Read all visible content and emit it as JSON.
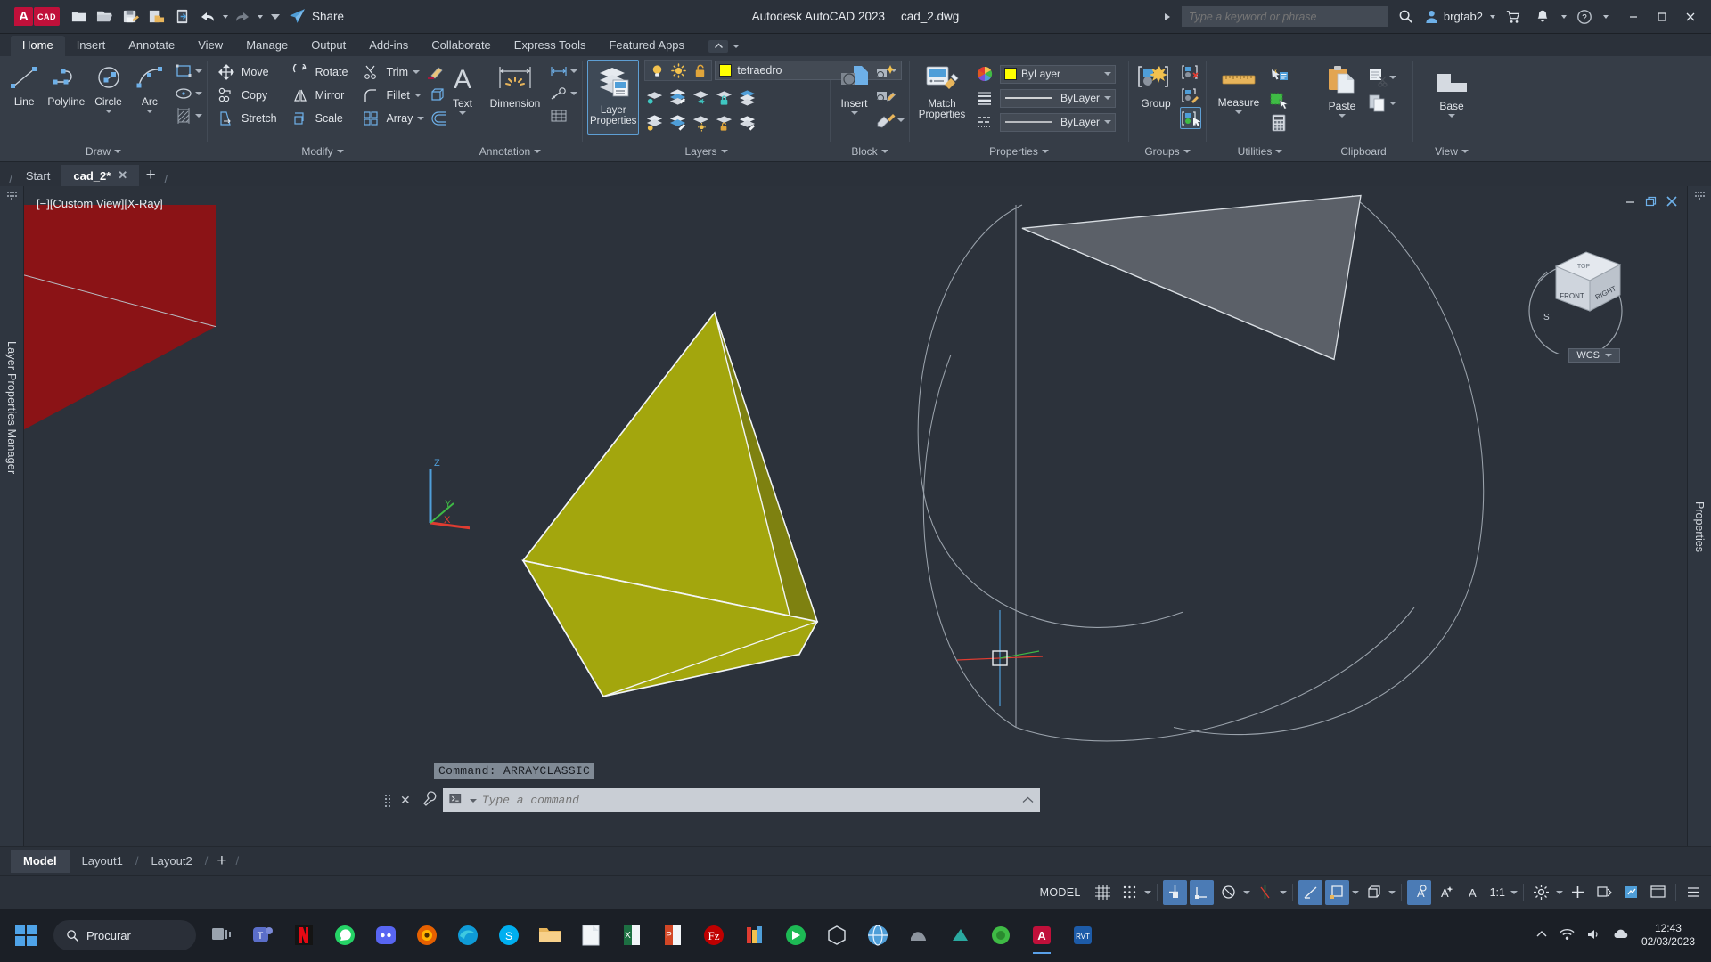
{
  "titlebar": {
    "logo_a": "A",
    "logo_cad": "CAD",
    "share_label": "Share",
    "app_title": "Autodesk AutoCAD 2023",
    "file_name": "cad_2.dwg",
    "search_placeholder": "Type a keyword or phrase",
    "user_name": "brgtab2",
    "quick_access": [
      {
        "name": "new-icon",
        "label": "New"
      },
      {
        "name": "open-icon",
        "label": "Open"
      },
      {
        "name": "save-icon",
        "label": "Save"
      },
      {
        "name": "save-as-icon",
        "label": "Save As"
      },
      {
        "name": "plot-icon",
        "label": "Plot"
      },
      {
        "name": "undo-icon",
        "label": "Undo"
      },
      {
        "name": "redo-icon",
        "label": "Redo"
      }
    ]
  },
  "ribbon_tabs": [
    {
      "label": "Home",
      "active": true
    },
    {
      "label": "Insert",
      "active": false
    },
    {
      "label": "Annotate",
      "active": false
    },
    {
      "label": "View",
      "active": false
    },
    {
      "label": "Manage",
      "active": false
    },
    {
      "label": "Output",
      "active": false
    },
    {
      "label": "Add-ins",
      "active": false
    },
    {
      "label": "Collaborate",
      "active": false
    },
    {
      "label": "Express Tools",
      "active": false
    },
    {
      "label": "Featured Apps",
      "active": false
    }
  ],
  "panels": {
    "draw": {
      "label": "Draw",
      "buttons": [
        {
          "label": "Line",
          "icon": "line-icon",
          "dropdown": false
        },
        {
          "label": "Polyline",
          "icon": "polyline-icon",
          "dropdown": false
        },
        {
          "label": "Circle",
          "icon": "circle-icon",
          "dropdown": true
        },
        {
          "label": "Arc",
          "icon": "arc-icon",
          "dropdown": true
        }
      ],
      "small": [
        {
          "icon": "rectangle-icon",
          "dropdown": true
        },
        {
          "icon": "ellipse-icon",
          "dropdown": true
        },
        {
          "icon": "hatch-icon",
          "dropdown": true
        }
      ]
    },
    "modify": {
      "label": "Modify",
      "items": [
        {
          "label": "Move",
          "icon": "move-icon"
        },
        {
          "label": "Rotate",
          "icon": "rotate-icon"
        },
        {
          "label": "Trim",
          "icon": "trim-icon",
          "dropdown": true
        },
        {
          "label": "Copy",
          "icon": "copy-icon"
        },
        {
          "label": "Mirror",
          "icon": "mirror-icon"
        },
        {
          "label": "Fillet",
          "icon": "fillet-icon",
          "dropdown": true
        },
        {
          "label": "Stretch",
          "icon": "stretch-icon"
        },
        {
          "label": "Scale",
          "icon": "scale-icon"
        },
        {
          "label": "Array",
          "icon": "array-icon",
          "dropdown": true
        }
      ],
      "extra": [
        {
          "icon": "erase-icon"
        },
        {
          "icon": "3d-solid-icon"
        },
        {
          "icon": "offset-icon"
        }
      ]
    },
    "annotation": {
      "label": "Annotation",
      "text_label": "Text",
      "dimension_label": "Dimension",
      "small": [
        {
          "icon": "linear-dimension-icon",
          "dropdown": true
        },
        {
          "icon": "leader-icon",
          "dropdown": true
        },
        {
          "icon": "table-icon",
          "dropdown": false
        }
      ]
    },
    "layers": {
      "label": "Layers",
      "layer_properties_label": "Layer Properties",
      "current_layer": "tetraedro",
      "layer_color": "#ffff00",
      "toggles": [
        {
          "name": "layer-on-icon"
        },
        {
          "name": "layer-freeze-sun-icon"
        },
        {
          "name": "layer-unlock-icon"
        }
      ],
      "grid_icons": [
        "layer-isolate-icon",
        "layer-unisolate-icon",
        "layer-freeze-icon",
        "layer-lock-icon",
        "layer-make-current-icon",
        "layer-off-icon",
        "layer-match-icon",
        "layer-thaw-all-icon",
        "layer-unlock-obj-icon",
        "layer-previous-icon"
      ]
    },
    "block": {
      "label": "Block",
      "insert_label": "Insert",
      "small": [
        {
          "icon": "create-block-icon"
        },
        {
          "icon": "edit-block-icon"
        },
        {
          "icon": "edit-attribute-icon",
          "dropdown": true
        }
      ]
    },
    "properties": {
      "label": "Properties",
      "match_properties_label": "Match Properties",
      "rows": [
        {
          "icon": "color-wheel-icon",
          "swatch": "#ffff00",
          "value": "ByLayer",
          "kind": "color"
        },
        {
          "icon": "lineweight-icon",
          "value": "ByLayer",
          "kind": "lineweight"
        },
        {
          "icon": "linetype-icon",
          "value": "ByLayer",
          "kind": "linetype"
        }
      ]
    },
    "groups": {
      "label": "Groups",
      "group_label": "Group",
      "small": [
        {
          "icon": "ungroup-icon"
        },
        {
          "icon": "group-edit-icon"
        },
        {
          "icon": "group-selection-icon",
          "active": true
        }
      ]
    },
    "utilities": {
      "label": "Utilities",
      "measure_label": "Measure",
      "small": [
        {
          "icon": "quick-select-icon"
        },
        {
          "icon": "quick-calc-area-icon"
        },
        {
          "icon": "calculator-icon"
        }
      ]
    },
    "clipboard": {
      "label": "Clipboard",
      "paste_label": "Paste",
      "small": [
        {
          "icon": "cut-icon",
          "dropdown": true
        },
        {
          "icon": "copy-clip-icon",
          "dropdown": true
        }
      ]
    },
    "view": {
      "label": "View",
      "base_label": "Base"
    }
  },
  "file_tabs": [
    {
      "label": "Start",
      "active": false,
      "closable": false
    },
    {
      "label": "cad_2*",
      "active": true,
      "closable": true
    }
  ],
  "viewport": {
    "label": "[−][Custom View][X-Ray]",
    "viewcube": {
      "top": "TOP",
      "front": "FRONT",
      "right": "RIGHT",
      "compass_s": "S"
    },
    "wcs_label": "WCS",
    "ucs_axes": {
      "x": "X",
      "y": "Y",
      "z": "Z"
    },
    "colors": {
      "background": "#2c323b",
      "tetra_fill": "#a3a60d",
      "tetra_fill_dark": "#7e8110",
      "highlight_red": "#8b1316",
      "gray_face": "#5b6068"
    }
  },
  "command_line": {
    "history": "Command: ARRAYCLASSIC",
    "placeholder": "Type a command"
  },
  "layout_tabs": [
    {
      "label": "Model",
      "active": true
    },
    {
      "label": "Layout1",
      "active": false
    },
    {
      "label": "Layout2",
      "active": false
    }
  ],
  "status_bar": {
    "model_label": "MODEL",
    "scale": "1:1",
    "items": [
      {
        "name": "grid-display-toggle",
        "on": false
      },
      {
        "name": "snap-mode-toggle",
        "on": false
      },
      {
        "name": "ortho-mode-toggle",
        "on": true
      },
      {
        "name": "polar-tracking-toggle",
        "on": true
      },
      {
        "name": "isometric-drafting-toggle",
        "on": false
      },
      {
        "name": "object-snap-tracking-toggle",
        "on": false
      },
      {
        "name": "object-snap-toggle",
        "on": true
      },
      {
        "name": "dynamic-ucs-toggle",
        "on": true
      },
      {
        "name": "3d-object-snap-toggle",
        "on": false
      },
      {
        "name": "annotation-visibility-toggle",
        "on": true
      },
      {
        "name": "auto-scale-toggle",
        "on": false
      },
      {
        "name": "annotation-scale-toggle",
        "on": false
      },
      {
        "name": "workspace-settings-icon",
        "on": false
      },
      {
        "name": "customization-icon",
        "on": false
      },
      {
        "name": "isolate-objects-icon",
        "on": false
      },
      {
        "name": "hardware-acceleration-icon",
        "on": false
      },
      {
        "name": "clean-screen-icon",
        "on": false
      }
    ]
  },
  "panel_labels": {
    "left_palette": "Layer Properties Manager",
    "right_palette": "Properties"
  },
  "taskbar": {
    "search_placeholder": "Procurar",
    "clock_time": "12:43",
    "clock_date": "02/03/2023",
    "apps": [
      {
        "name": "task-view-icon",
        "color": "#9aa3ae"
      },
      {
        "name": "teams-icon",
        "color": "#5b6ec9"
      },
      {
        "name": "netflix-icon",
        "color": "#e50914"
      },
      {
        "name": "whatsapp-icon",
        "color": "#25d366"
      },
      {
        "name": "discord-icon",
        "color": "#5865f2"
      },
      {
        "name": "firefox-icon",
        "color": "#e66000"
      },
      {
        "name": "edge-icon",
        "color": "#0f9bd7"
      },
      {
        "name": "skype-icon",
        "color": "#00aff0"
      },
      {
        "name": "file-explorer-icon",
        "color": "#e8b55b"
      },
      {
        "name": "word-icon",
        "color": "#e9eef3"
      },
      {
        "name": "excel-icon",
        "color": "#1d6f42"
      },
      {
        "name": "powerpoint-icon",
        "color": "#d24726"
      },
      {
        "name": "filezilla-icon",
        "color": "#bf0000"
      },
      {
        "name": "colors-app-icon",
        "color": "#e8b55b"
      },
      {
        "name": "quick-access-icon",
        "color": "#1db954"
      },
      {
        "name": "3d-viewer-icon",
        "color": "#cfd5dc"
      },
      {
        "name": "browser-icon",
        "color": "#4f9ed8"
      },
      {
        "name": "gray-app-icon",
        "color": "#8d949e"
      },
      {
        "name": "teal-app-icon",
        "color": "#2aa9a0"
      },
      {
        "name": "green-circle-icon",
        "color": "#3fbb45"
      },
      {
        "name": "autocad-icon",
        "color": "#c0103a",
        "active": true
      },
      {
        "name": "bluebeam-icon",
        "color": "#1d5ba8"
      }
    ]
  }
}
